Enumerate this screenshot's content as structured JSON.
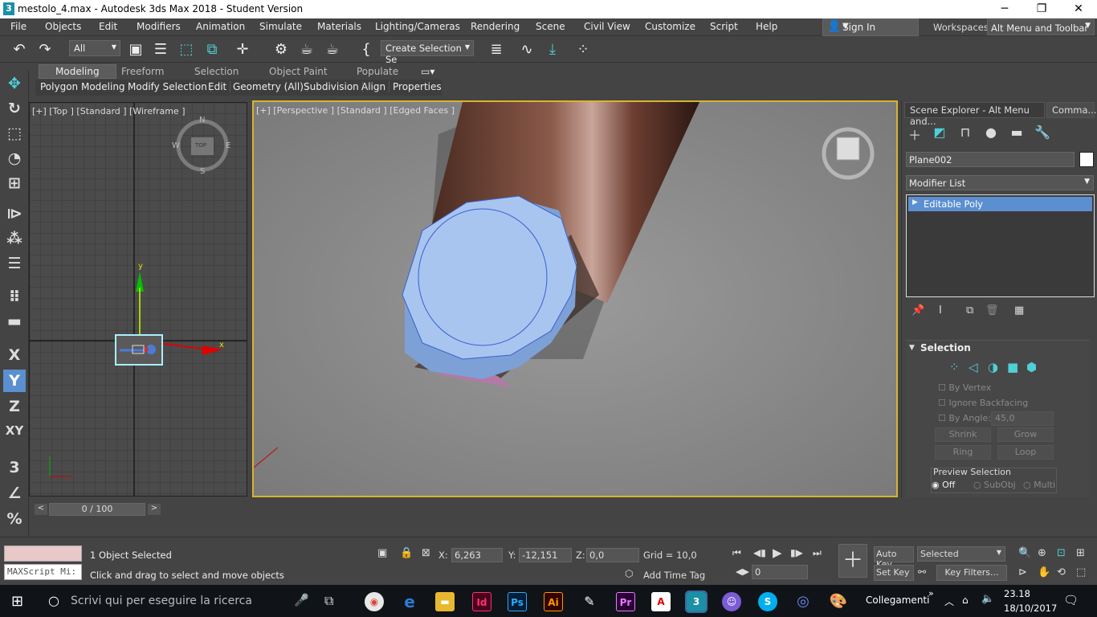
{
  "window": {
    "title": "mestolo_4.max - Autodesk 3ds Max 2018 - Student Version",
    "app_icon_label": "3"
  },
  "menu": [
    "File",
    "Objects",
    "Edit",
    "Modifiers",
    "Animation",
    "Simulate",
    "Materials",
    "Lighting/Cameras",
    "Rendering",
    "Scene",
    "Civil View",
    "Customize",
    "Script",
    "Help"
  ],
  "sign_in": "Sign In",
  "workspaces": {
    "label": "Workspaces:",
    "value": "Alt Menu and Toolbar"
  },
  "toolbar": {
    "filter": "All",
    "selection_set": "Create Selection Se"
  },
  "ribbon": {
    "tabs": [
      "Modeling",
      "Freeform",
      "Selection",
      "Object Paint",
      "Populate"
    ],
    "buttons": [
      "Polygon Modeling",
      "Modify Selection",
      "Edit",
      "Geometry (All)",
      "Subdivision",
      "Align",
      "Properties"
    ]
  },
  "left_tools": {
    "x": "X",
    "y": "Y",
    "z": "Z",
    "xy": "XY"
  },
  "viewport_top": {
    "label": "[+] [Top ] [Standard ] [Wireframe ]",
    "compass": {
      "n": "N",
      "s": "S",
      "e": "E",
      "w": "W",
      "center": "TOP"
    },
    "axis_y": "y",
    "axis_x": "x"
  },
  "viewport_persp": {
    "label": "[+] [Perspective ] [Standard ] [Edged Faces ]"
  },
  "right_panel": {
    "tabs": [
      "Scene Explorer - Alt Menu and...",
      "Comma..."
    ],
    "object_name": "Plane002",
    "modifier_list": "Modifier List",
    "stack_item": "Editable Poly",
    "rollout_title": "Selection",
    "by_vertex": "By Vertex",
    "ignore_backfacing": "Ignore Backfacing",
    "by_angle": "By Angle:",
    "angle_value": "45,0",
    "shrink": "Shrink",
    "grow": "Grow",
    "ring": "Ring",
    "loop": "Loop",
    "preview_selection": "Preview Selection",
    "preview_off": "Off",
    "preview_subobj": "SubObj",
    "preview_multi": "Multi"
  },
  "timeline": {
    "frame": "0 / 100"
  },
  "status": {
    "maxscript": "MAXScript Mi:",
    "selected": "1 Object Selected",
    "prompt": "Click and drag to select and move objects",
    "x_label": "X:",
    "x_value": "6,263",
    "y_label": "Y:",
    "y_value": "-12,151",
    "z_label": "Z:",
    "z_value": "0,0",
    "grid": "Grid = 10,0",
    "add_time_tag": "Add Time Tag",
    "auto_key": "Auto Key",
    "set_key": "Set Key",
    "key_mode": "Selected",
    "key_filters": "Key Filters...",
    "frame_field": "0"
  },
  "taskbar": {
    "search": "Scrivi qui per eseguire la ricerca",
    "network": "Collegamenti",
    "time": "23.18",
    "date": "18/10/2017",
    "apps": [
      "Id",
      "Ps",
      "Ai",
      "Pr",
      "3"
    ]
  },
  "colors": {
    "accent": "#5b8fd0",
    "viewport_border": "#d8b430",
    "cyan": "#4fd0d8"
  }
}
